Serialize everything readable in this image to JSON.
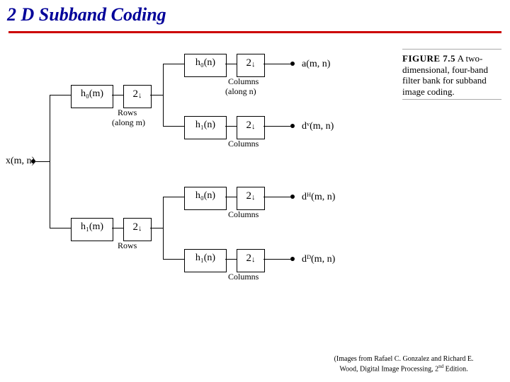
{
  "title": "2 D Subband Coding",
  "input": "x(m, n)",
  "rows_label": "Rows",
  "rows_sub": "(along m)",
  "cols_label": "Columns",
  "cols_sub": "(along n)",
  "filters": {
    "h0m": "h₀(m)",
    "h1m": "h₁(m)",
    "h0n": "h₀(n)",
    "h1n": "h₁(n)"
  },
  "down": "2",
  "outputs": {
    "a": "a(m, n)",
    "dV": "dᵛ(m, n)",
    "dH": "dᴴ(m, n)",
    "dD": "dᴰ(m, n)"
  },
  "caption": {
    "head": "FIGURE 7.5",
    "body": "A two-dimensional, four-band filter bank for subband image coding."
  },
  "credit_line1": "(Images from Rafael C. Gonzalez and Richard E.",
  "credit_line2": "Wood, Digital Image Processing, 2",
  "credit_suffix": " Edition."
}
